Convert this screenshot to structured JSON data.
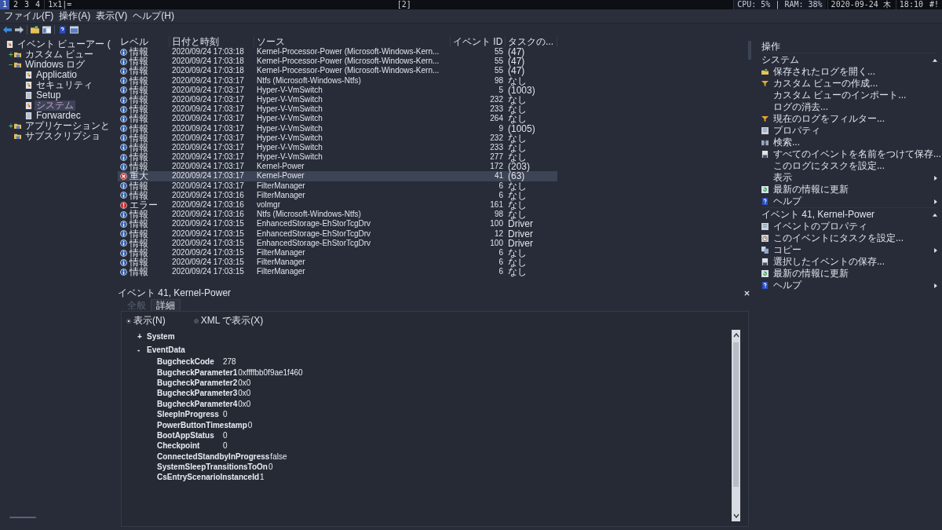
{
  "top_bar": {
    "workspaces": [
      {
        "label": "1",
        "selected": true
      },
      {
        "label": "2",
        "selected": false
      },
      {
        "label": "3",
        "selected": false
      },
      {
        "label": "4",
        "selected": false
      }
    ],
    "layout": "1x1|=",
    "center": "[2]",
    "stats": "CPU:  5% | RAM:  38%",
    "date": "2020-09-24 木",
    "time": "18:10",
    "tail": "#!"
  },
  "menu": [
    "ファイル(F)",
    "操作(A)",
    "表示(V)",
    "ヘルプ(H)"
  ],
  "tree": [
    {
      "label": "イベント ビューアー (",
      "kind": "app",
      "selected": false,
      "children": [
        {
          "label": "カスタム ビュー",
          "kind": "folder",
          "toggle": "+",
          "selected": false
        },
        {
          "label": "Windows ログ",
          "kind": "folder",
          "toggle": "−",
          "selected": false,
          "children": [
            {
              "label": "Applicatio",
              "kind": "log",
              "selected": false
            },
            {
              "label": "セキュリティ",
              "kind": "log",
              "selected": false
            },
            {
              "label": "Setup",
              "kind": "page",
              "selected": false
            },
            {
              "label": "システム",
              "kind": "log",
              "selected": true
            },
            {
              "label": "Forwardec",
              "kind": "page",
              "selected": false
            }
          ]
        },
        {
          "label": "アプリケーションと",
          "kind": "folder",
          "toggle": "+",
          "selected": false
        },
        {
          "label": "サブスクリプショ",
          "kind": "folder",
          "selected": false
        }
      ]
    }
  ],
  "table": {
    "columns": [
      "レベル",
      "日付と時刻",
      "ソース",
      "イベント ID",
      "タスクの..."
    ],
    "rows": [
      {
        "kind": "info",
        "level": "情報",
        "date": "2020/09/24 17:03:18",
        "source": "Kernel-Processor-Power (Microsoft-Windows-Kern...",
        "id": "55",
        "task": "(47)",
        "selected": false
      },
      {
        "kind": "info",
        "level": "情報",
        "date": "2020/09/24 17:03:18",
        "source": "Kernel-Processor-Power (Microsoft-Windows-Kern...",
        "id": "55",
        "task": "(47)",
        "selected": false
      },
      {
        "kind": "info",
        "level": "情報",
        "date": "2020/09/24 17:03:18",
        "source": "Kernel-Processor-Power (Microsoft-Windows-Kern...",
        "id": "55",
        "task": "(47)",
        "selected": false
      },
      {
        "kind": "info",
        "level": "情報",
        "date": "2020/09/24 17:03:17",
        "source": "Ntfs (Microsoft-Windows-Ntfs)",
        "id": "98",
        "task": "なし",
        "selected": false
      },
      {
        "kind": "info",
        "level": "情報",
        "date": "2020/09/24 17:03:17",
        "source": "Hyper-V-VmSwitch",
        "id": "5",
        "task": "(1003)",
        "selected": false
      },
      {
        "kind": "info",
        "level": "情報",
        "date": "2020/09/24 17:03:17",
        "source": "Hyper-V-VmSwitch",
        "id": "232",
        "task": "なし",
        "selected": false
      },
      {
        "kind": "info",
        "level": "情報",
        "date": "2020/09/24 17:03:17",
        "source": "Hyper-V-VmSwitch",
        "id": "233",
        "task": "なし",
        "selected": false
      },
      {
        "kind": "info",
        "level": "情報",
        "date": "2020/09/24 17:03:17",
        "source": "Hyper-V-VmSwitch",
        "id": "264",
        "task": "なし",
        "selected": false
      },
      {
        "kind": "info",
        "level": "情報",
        "date": "2020/09/24 17:03:17",
        "source": "Hyper-V-VmSwitch",
        "id": "9",
        "task": "(1005)",
        "selected": false
      },
      {
        "kind": "info",
        "level": "情報",
        "date": "2020/09/24 17:03:17",
        "source": "Hyper-V-VmSwitch",
        "id": "232",
        "task": "なし",
        "selected": false
      },
      {
        "kind": "info",
        "level": "情報",
        "date": "2020/09/24 17:03:17",
        "source": "Hyper-V-VmSwitch",
        "id": "233",
        "task": "なし",
        "selected": false
      },
      {
        "kind": "info",
        "level": "情報",
        "date": "2020/09/24 17:03:17",
        "source": "Hyper-V-VmSwitch",
        "id": "277",
        "task": "なし",
        "selected": false
      },
      {
        "kind": "info",
        "level": "情報",
        "date": "2020/09/24 17:03:17",
        "source": "Kernel-Power",
        "id": "172",
        "task": "(203)",
        "selected": false
      },
      {
        "kind": "critical",
        "level": "重大",
        "date": "2020/09/24 17:03:17",
        "source": "Kernel-Power",
        "id": "41",
        "task": "(63)",
        "selected": true
      },
      {
        "kind": "info",
        "level": "情報",
        "date": "2020/09/24 17:03:17",
        "source": "FilterManager",
        "id": "6",
        "task": "なし",
        "selected": false
      },
      {
        "kind": "info",
        "level": "情報",
        "date": "2020/09/24 17:03:16",
        "source": "FilterManager",
        "id": "6",
        "task": "なし",
        "selected": false
      },
      {
        "kind": "error",
        "level": "エラー",
        "date": "2020/09/24 17:03:16",
        "source": "volmgr",
        "id": "161",
        "task": "なし",
        "selected": false
      },
      {
        "kind": "info",
        "level": "情報",
        "date": "2020/09/24 17:03:16",
        "source": "Ntfs (Microsoft-Windows-Ntfs)",
        "id": "98",
        "task": "なし",
        "selected": false
      },
      {
        "kind": "info",
        "level": "情報",
        "date": "2020/09/24 17:03:15",
        "source": "EnhancedStorage-EhStorTcgDrv",
        "id": "100",
        "task": "Driver",
        "selected": false
      },
      {
        "kind": "info",
        "level": "情報",
        "date": "2020/09/24 17:03:15",
        "source": "EnhancedStorage-EhStorTcgDrv",
        "id": "12",
        "task": "Driver",
        "selected": false
      },
      {
        "kind": "info",
        "level": "情報",
        "date": "2020/09/24 17:03:15",
        "source": "EnhancedStorage-EhStorTcgDrv",
        "id": "100",
        "task": "Driver",
        "selected": false
      },
      {
        "kind": "info",
        "level": "情報",
        "date": "2020/09/24 17:03:15",
        "source": "FilterManager",
        "id": "6",
        "task": "なし",
        "selected": false
      },
      {
        "kind": "info",
        "level": "情報",
        "date": "2020/09/24 17:03:15",
        "source": "FilterManager",
        "id": "6",
        "task": "なし",
        "selected": false
      },
      {
        "kind": "info",
        "level": "情報",
        "date": "2020/09/24 17:03:15",
        "source": "FilterManager",
        "id": "6",
        "task": "なし",
        "selected": false
      }
    ]
  },
  "detail": {
    "title": "イベント 41, Kernel-Power",
    "tabs": [
      {
        "label": "全般",
        "selected": false
      },
      {
        "label": "詳細",
        "selected": true
      }
    ],
    "radios": [
      {
        "label": "表示(N)",
        "selected": true
      },
      {
        "label": "XML で表示(X)",
        "selected": false
      }
    ],
    "sections": [
      {
        "toggle": "+",
        "label": "System"
      },
      {
        "toggle": "-",
        "label": "EventData",
        "fields": [
          {
            "key": "BugcheckCode",
            "value": "278"
          },
          {
            "key": "BugcheckParameter1",
            "value": "0xffffbb0f9ae1f460"
          },
          {
            "key": "BugcheckParameter2",
            "value": "0x0"
          },
          {
            "key": "BugcheckParameter3",
            "value": "0x0"
          },
          {
            "key": "BugcheckParameter4",
            "value": "0x0"
          },
          {
            "key": "SleepInProgress",
            "value": "0"
          },
          {
            "key": "PowerButtonTimestamp",
            "value": "0"
          },
          {
            "key": "BootAppStatus",
            "value": "0"
          },
          {
            "key": "Checkpoint",
            "value": "0"
          },
          {
            "key": "ConnectedStandbyInProgress",
            "value": "false"
          },
          {
            "key": "SystemSleepTransitionsToOn",
            "value": "0"
          },
          {
            "key": "CsEntryScenarioInstanceId",
            "value": "1"
          }
        ]
      }
    ]
  },
  "actions": {
    "title": "操作",
    "sections": [
      {
        "title": "システム",
        "expanded": true,
        "items": [
          {
            "kind": "open",
            "label": "保存されたログを開く...",
            "submenu": false
          },
          {
            "kind": "filter",
            "label": "カスタム ビューの作成...",
            "submenu": false
          },
          {
            "kind": "plain",
            "label": "カスタム ビューのインポート...",
            "submenu": false
          },
          {
            "kind": "plain",
            "label": "ログの消去...",
            "submenu": false
          },
          {
            "kind": "filter",
            "label": "現在のログをフィルター...",
            "submenu": false
          },
          {
            "kind": "props",
            "label": "プロパティ",
            "submenu": false
          },
          {
            "kind": "find",
            "label": "検索...",
            "submenu": false
          },
          {
            "kind": "save",
            "label": "すべてのイベントを名前をつけて保存...",
            "submenu": false
          },
          {
            "kind": "plain",
            "label": "このログにタスクを設定...",
            "submenu": false
          },
          {
            "kind": "plain",
            "label": "表示",
            "submenu": true
          },
          {
            "kind": "refresh",
            "label": "最新の情報に更新",
            "submenu": false
          },
          {
            "kind": "help",
            "label": "ヘルプ",
            "submenu": true
          }
        ]
      },
      {
        "title": "イベント 41, Kernel-Power",
        "expanded": true,
        "items": [
          {
            "kind": "props",
            "label": "イベントのプロパティ",
            "submenu": false
          },
          {
            "kind": "task",
            "label": "このイベントにタスクを設定...",
            "submenu": false
          },
          {
            "kind": "copy",
            "label": "コピー",
            "submenu": true
          },
          {
            "kind": "save",
            "label": "選択したイベントの保存...",
            "submenu": false
          },
          {
            "kind": "refresh",
            "label": "最新の情報に更新",
            "submenu": false
          },
          {
            "kind": "help",
            "label": "ヘルプ",
            "submenu": true
          }
        ]
      }
    ]
  }
}
